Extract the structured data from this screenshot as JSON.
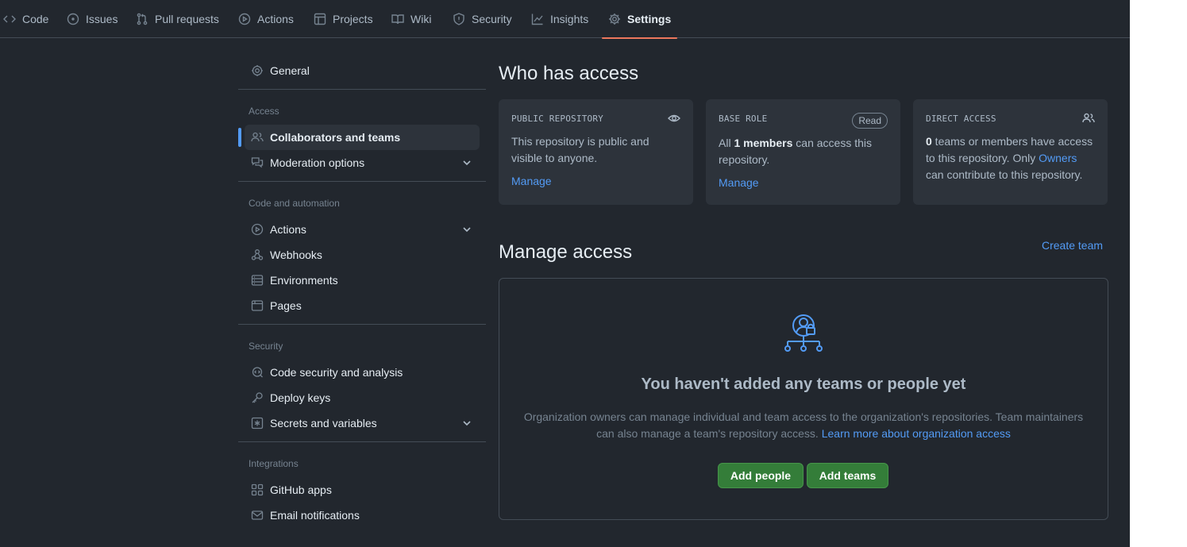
{
  "repo_tabs": [
    {
      "label": "Code",
      "icon": "code-icon"
    },
    {
      "label": "Issues",
      "icon": "issue-icon"
    },
    {
      "label": "Pull requests",
      "icon": "pull-request-icon"
    },
    {
      "label": "Actions",
      "icon": "play-icon"
    },
    {
      "label": "Projects",
      "icon": "table-icon"
    },
    {
      "label": "Wiki",
      "icon": "book-icon"
    },
    {
      "label": "Security",
      "icon": "shield-icon"
    },
    {
      "label": "Insights",
      "icon": "graph-icon"
    },
    {
      "label": "Settings",
      "icon": "gear-icon",
      "selected": true
    }
  ],
  "sidebar": {
    "general": "General",
    "sections": [
      {
        "heading": "Access",
        "items": [
          {
            "label": "Collaborators and teams",
            "icon": "people-icon",
            "active": true
          },
          {
            "label": "Moderation options",
            "icon": "comment-discussion-icon",
            "expandable": true
          }
        ]
      },
      {
        "heading": "Code and automation",
        "items": [
          {
            "label": "Actions",
            "icon": "play-icon",
            "expandable": true
          },
          {
            "label": "Webhooks",
            "icon": "webhook-icon"
          },
          {
            "label": "Environments",
            "icon": "server-icon"
          },
          {
            "label": "Pages",
            "icon": "browser-icon"
          }
        ]
      },
      {
        "heading": "Security",
        "items": [
          {
            "label": "Code security and analysis",
            "icon": "codescan-icon"
          },
          {
            "label": "Deploy keys",
            "icon": "key-icon"
          },
          {
            "label": "Secrets and variables",
            "icon": "asterisk-icon",
            "expandable": true
          }
        ]
      },
      {
        "heading": "Integrations",
        "items": [
          {
            "label": "GitHub apps",
            "icon": "apps-icon"
          },
          {
            "label": "Email notifications",
            "icon": "mail-icon"
          }
        ]
      }
    ]
  },
  "who_has_access": {
    "title": "Who has access",
    "cards": [
      {
        "label": "PUBLIC REPOSITORY",
        "icon": "eye-icon",
        "text": "This repository is public and visible to anyone.",
        "link": "Manage"
      },
      {
        "label": "BASE ROLE",
        "badge": "Read",
        "text_prefix": "All ",
        "text_bold": "1 members",
        "text_suffix": " can access this repository.",
        "link": "Manage"
      },
      {
        "label": "DIRECT ACCESS",
        "icon": "people-icon",
        "text_bold": "0",
        "text_mid": " teams or members have access to this repository. Only ",
        "text_link": "Owners",
        "text_suffix": " can contribute to this repository."
      }
    ]
  },
  "manage_access": {
    "title": "Manage access",
    "create_team": "Create team",
    "blankslate_icon": "people-lock-icon",
    "heading": "You haven't added any teams or people yet",
    "description": "Organization owners can manage individual and team access to the organization's repositories. Team maintainers can also manage a team's repository access.",
    "learn_more": "Learn more about organization access",
    "add_people": "Add people",
    "add_teams": "Add teams"
  },
  "colors": {
    "background": "#22272e",
    "accent_link": "#539bf5",
    "primary_button": "#347d39",
    "selected_tab_underline": "#ec775c"
  }
}
